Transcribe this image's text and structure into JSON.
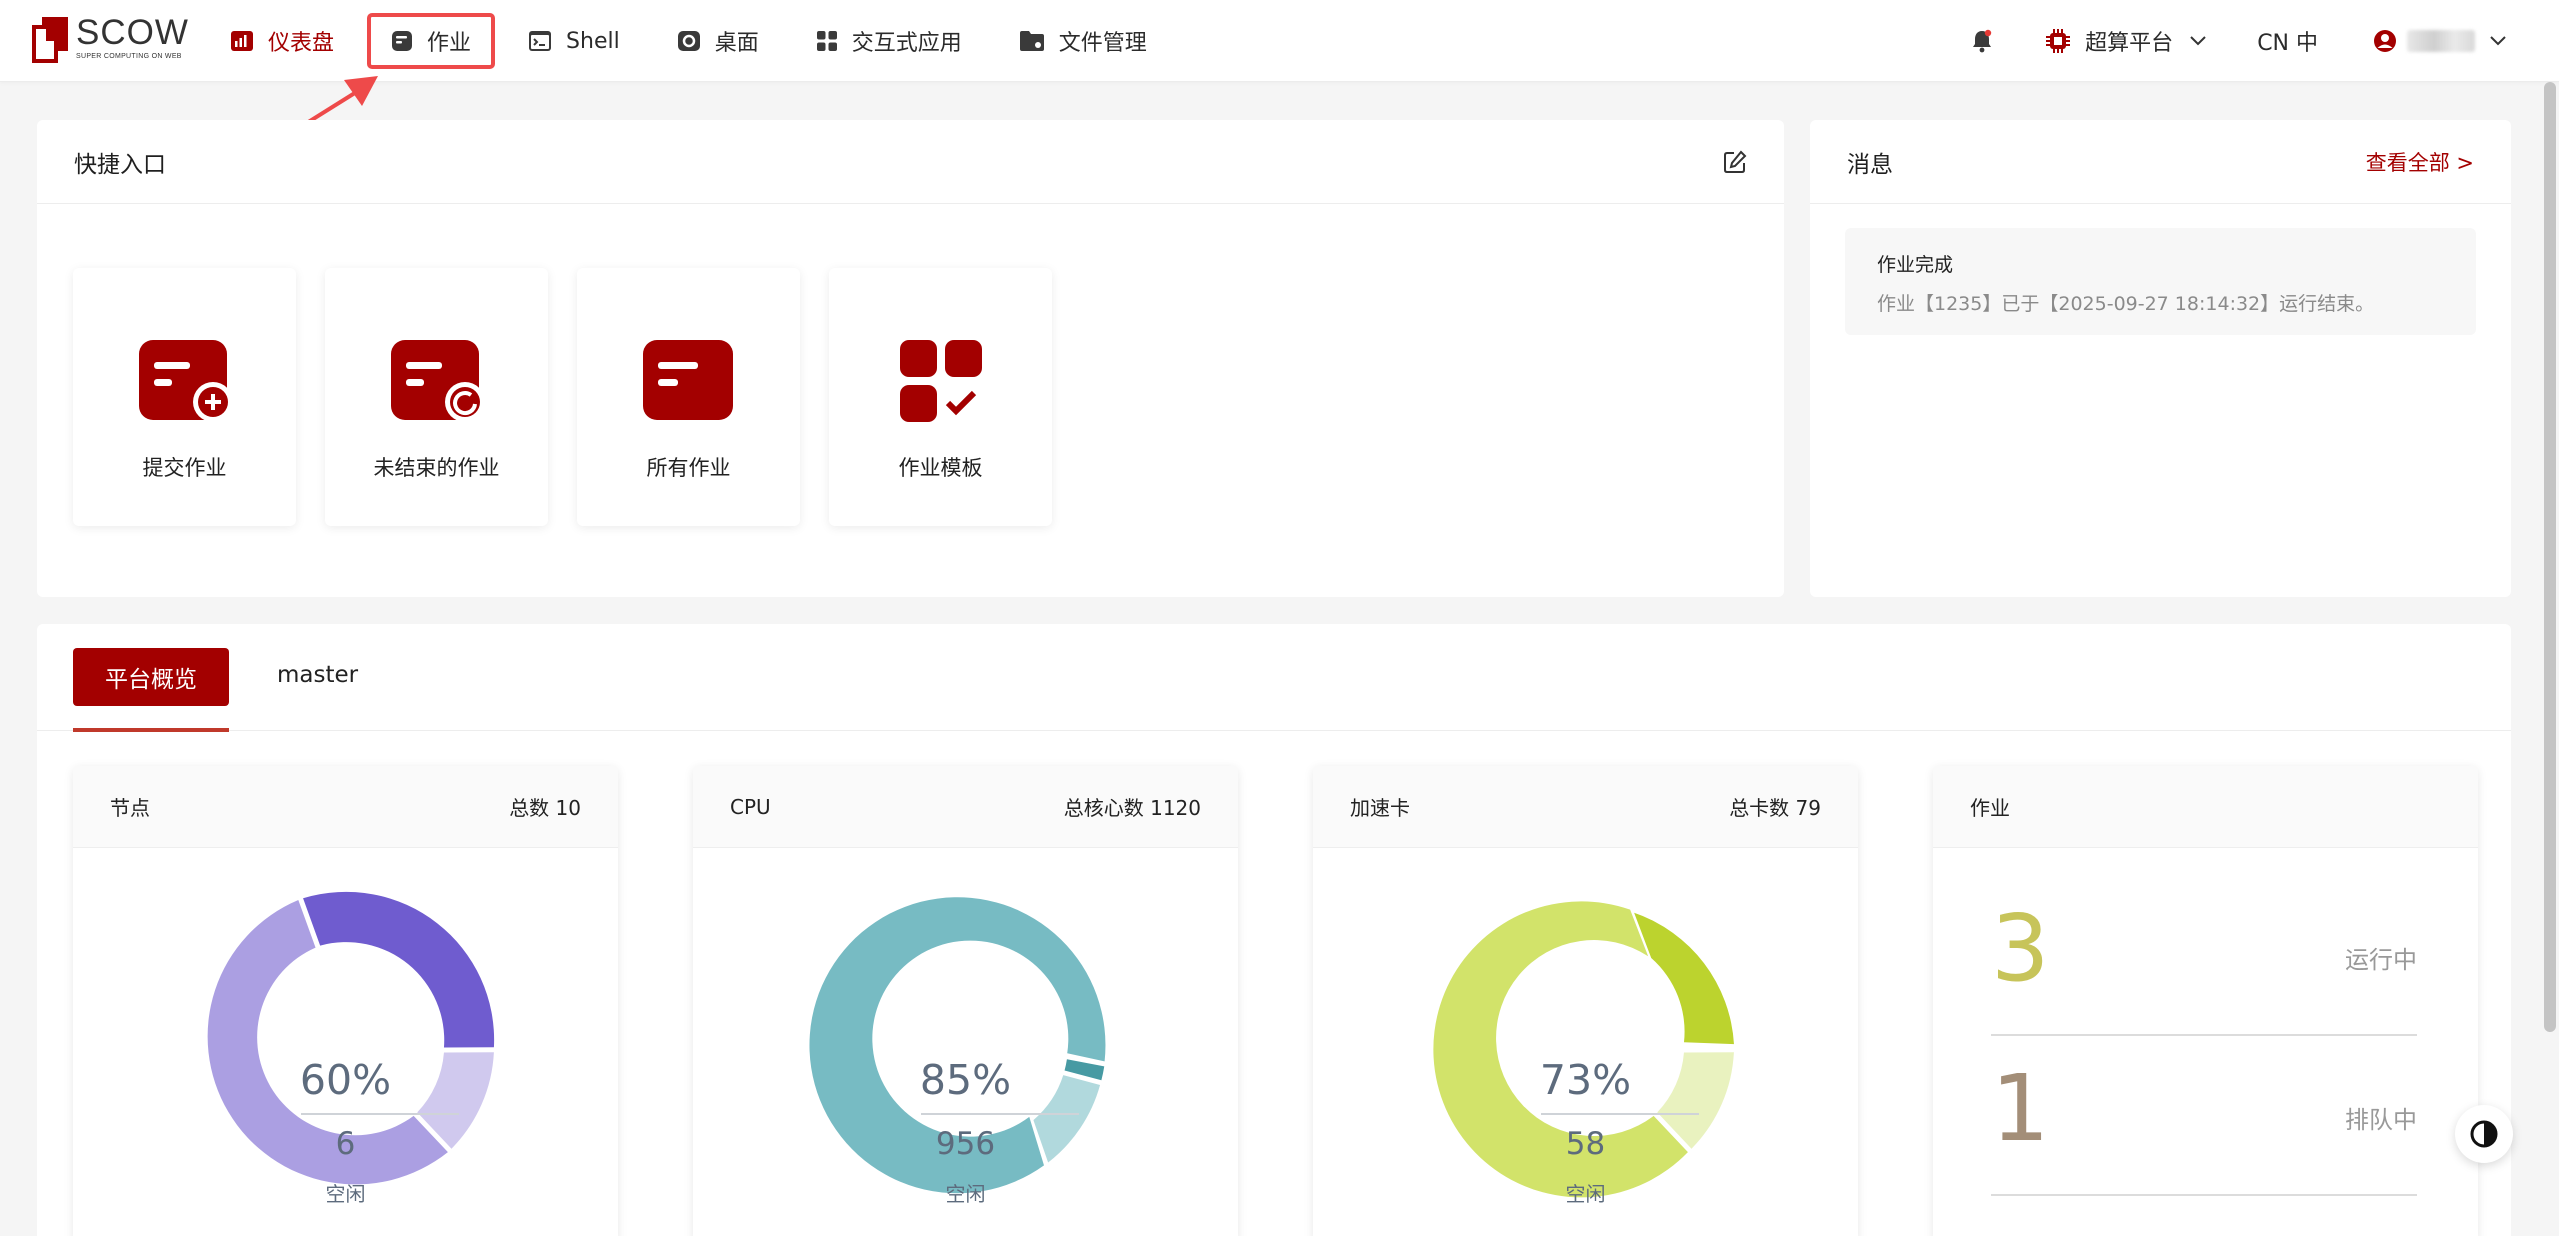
{
  "logo": {
    "name": "SCOW",
    "subtitle": "SUPER COMPUTING ON WEB"
  },
  "nav": [
    {
      "label": "仪表盘",
      "icon": "dashboard-icon"
    },
    {
      "label": "作业",
      "icon": "job-icon"
    },
    {
      "label": "Shell",
      "icon": "terminal-icon"
    },
    {
      "label": "桌面",
      "icon": "desktop-icon"
    },
    {
      "label": "交互式应用",
      "icon": "apps-icon"
    },
    {
      "label": "文件管理",
      "icon": "folder-icon"
    }
  ],
  "header": {
    "platform": "超算平台",
    "language": "CN 中"
  },
  "quick_entry": {
    "title": "快捷入口",
    "tiles": [
      {
        "label": "提交作业",
        "icon": "submit-job-icon"
      },
      {
        "label": "未结束的作业",
        "icon": "running-job-icon"
      },
      {
        "label": "所有作业",
        "icon": "all-jobs-icon"
      },
      {
        "label": "作业模板",
        "icon": "job-template-icon"
      }
    ]
  },
  "messages": {
    "title": "消息",
    "view_all": "查看全部 >",
    "items": [
      {
        "title": "作业完成",
        "body": "作业【1235】已于【2025-09-27 18:14:32】运行结束。"
      }
    ]
  },
  "overview": {
    "tabs": [
      "平台概览",
      "master"
    ],
    "cards": [
      {
        "title": "节点",
        "total_label": "总数 10",
        "percent": "60%",
        "value": "6",
        "caption": "空闲"
      },
      {
        "title": "CPU",
        "total_label": "总核心数 1120",
        "percent": "85%",
        "value": "956",
        "caption": "空闲"
      },
      {
        "title": "加速卡",
        "total_label": "总卡数 79",
        "percent": "73%",
        "value": "58",
        "caption": "空闲"
      }
    ],
    "jobs": {
      "title": "作业",
      "running": "3",
      "running_label": "运行中",
      "pending": "1",
      "pending_label": "排队中"
    }
  },
  "colors": {
    "brand": "#a30000",
    "highlight_box": "#ee4a4a",
    "node_ring": [
      "#6f5ccf",
      "#d0c9ee",
      "#ab9fe2"
    ],
    "cpu_ring": [
      "#479aa3",
      "#b1d9dd",
      "#77bbc3"
    ],
    "card_ring": [
      "#bcd32e",
      "#e9f2bf",
      "#d2e36a"
    ],
    "running_num": "#c7c45a",
    "pending_num": "#a38e78"
  }
}
